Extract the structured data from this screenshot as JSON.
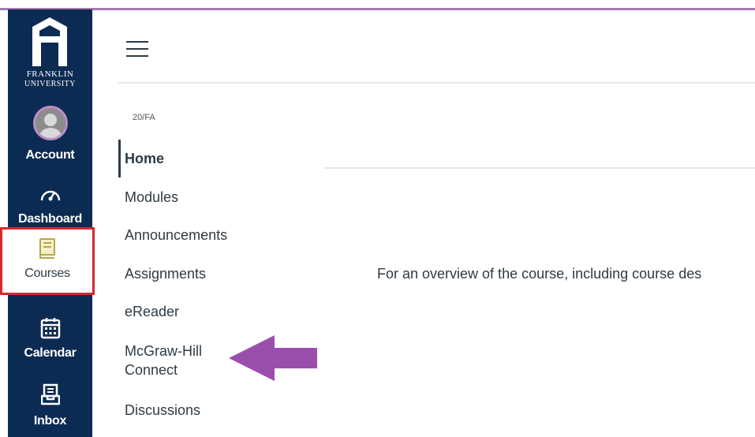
{
  "logo": {
    "line1": "FRANKLIN",
    "line2": "UNIVERSITY"
  },
  "global_nav": {
    "account": "Account",
    "dashboard": "Dashboard",
    "courses": "Courses",
    "calendar": "Calendar",
    "inbox": "Inbox"
  },
  "course": {
    "term": "20/FA"
  },
  "course_nav": {
    "home": "Home",
    "modules": "Modules",
    "announcements": "Announcements",
    "assignments": "Assignments",
    "ereader": "eReader",
    "mcgraw_line1": "McGraw-Hill",
    "mcgraw_line2": "Connect",
    "discussions": "Discussions"
  },
  "content": {
    "overview_text": "For an overview of the course, including course des"
  },
  "colors": {
    "nav_bg": "#0c2b52",
    "highlight_border": "#d92731",
    "annotation_arrow": "#9b4fad",
    "top_line": "#a57bb0"
  },
  "icons": [
    "menu-icon",
    "avatar-icon",
    "dashboard-icon",
    "courses-icon",
    "calendar-icon",
    "inbox-icon"
  ]
}
